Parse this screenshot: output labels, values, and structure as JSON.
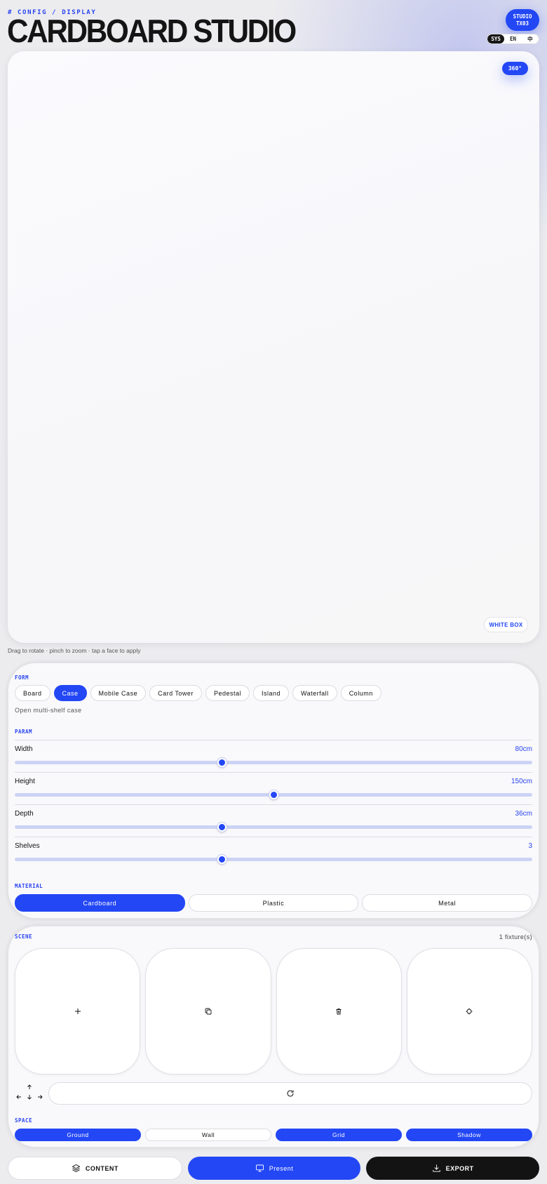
{
  "header": {
    "breadcrumb": "# CONFIG / DISPLAY",
    "title": "CARDBOARD STUDIO",
    "studio_badge_line1": "STUDIO",
    "studio_badge_line2": "TX03",
    "lang_options": [
      "SYS",
      "EN",
      "中"
    ],
    "lang_selected": "SYS"
  },
  "viewport": {
    "rotation_badge": "360°",
    "environment_badge": "WHITE BOX",
    "hint": "Drag to rotate · pinch to zoom · tap a face to apply"
  },
  "form": {
    "label": "FORM",
    "options": [
      "Board",
      "Case",
      "Mobile Case",
      "Card Tower",
      "Pedestal",
      "Island",
      "Waterfall",
      "Column"
    ],
    "selected": "Case",
    "description": "Open multi-shelf case"
  },
  "param": {
    "label": "PARAM",
    "items": [
      {
        "name": "Width",
        "value": "80cm",
        "level": 0.4
      },
      {
        "name": "Height",
        "value": "150cm",
        "level": 0.5
      },
      {
        "name": "Depth",
        "value": "36cm",
        "level": 0.4
      },
      {
        "name": "Shelves",
        "value": "3",
        "level": 0.4
      }
    ]
  },
  "material": {
    "label": "MATERIAL",
    "options": [
      "Cardboard",
      "Plastic",
      "Metal"
    ],
    "selected": "Cardboard"
  },
  "scene": {
    "label": "SCENE",
    "fixture_count": "1 fixture(s)",
    "tools": [
      "plus-icon",
      "duplicate-icon",
      "trash-icon",
      "crosshair-icon"
    ]
  },
  "space": {
    "label": "SPACE",
    "options": [
      "Ground",
      "Wall",
      "Grid",
      "Shadow"
    ],
    "active": [
      "Ground",
      "Grid",
      "Shadow"
    ]
  },
  "bottom_bar": {
    "content_label": "CONTENT",
    "present_label": "Present",
    "export_label": "EXPORT"
  },
  "colors": {
    "accent": "#2347f5",
    "dark": "#131313",
    "track": "#cdd3f5"
  }
}
